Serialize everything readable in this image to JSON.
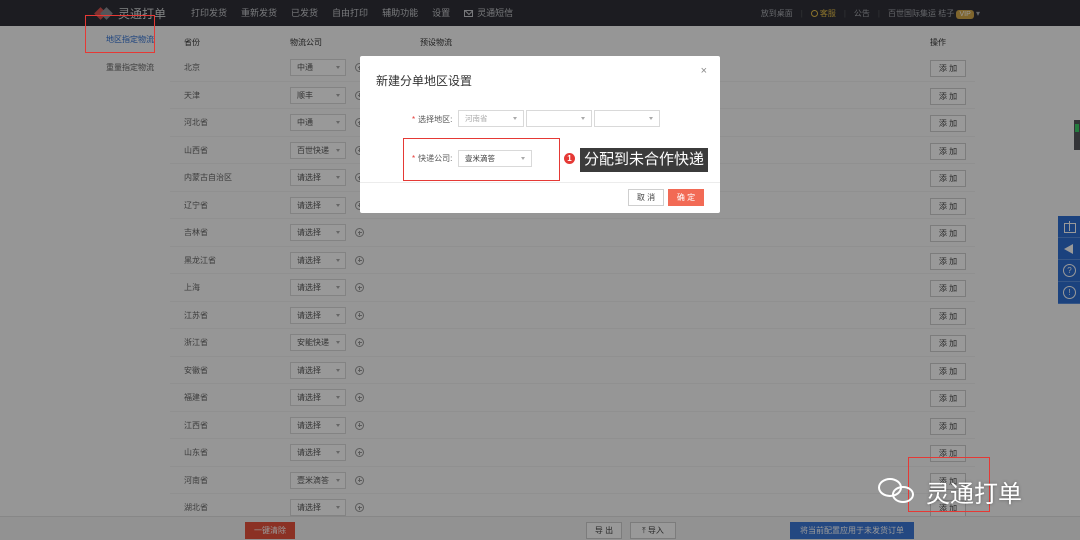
{
  "app": {
    "name": "灵通打单"
  },
  "nav": {
    "items": [
      "打印发货",
      "重新发货",
      "已发货",
      "自由打印",
      "辅助功能",
      "设置"
    ],
    "sms": "灵通短信"
  },
  "topright": {
    "desktop": "放到桌面",
    "service": "客服",
    "announce": "公告",
    "shop": "百世国际集运 桔子",
    "vip": "VIP"
  },
  "sidebar": {
    "items": [
      "地区指定物流",
      "重量指定物流"
    ]
  },
  "table": {
    "headers": {
      "province": "省份",
      "company": "物流公司",
      "preset": "预设物流",
      "action": "操作"
    },
    "add_label": "添 加",
    "rows": [
      {
        "province": "北京",
        "company": "中通"
      },
      {
        "province": "天津",
        "company": "顺丰"
      },
      {
        "province": "河北省",
        "company": "中通"
      },
      {
        "province": "山西省",
        "company": "百世快递"
      },
      {
        "province": "内蒙古自治区",
        "company": "请选择"
      },
      {
        "province": "辽宁省",
        "company": "请选择"
      },
      {
        "province": "吉林省",
        "company": "请选择"
      },
      {
        "province": "黑龙江省",
        "company": "请选择"
      },
      {
        "province": "上海",
        "company": "请选择"
      },
      {
        "province": "江苏省",
        "company": "请选择"
      },
      {
        "province": "浙江省",
        "company": "安能快递"
      },
      {
        "province": "安徽省",
        "company": "请选择"
      },
      {
        "province": "福建省",
        "company": "请选择"
      },
      {
        "province": "江西省",
        "company": "请选择"
      },
      {
        "province": "山东省",
        "company": "请选择"
      },
      {
        "province": "河南省",
        "company": "壹米滴答"
      },
      {
        "province": "湖北省",
        "company": "请选择"
      }
    ]
  },
  "footer": {
    "clear": "一键清除",
    "export": "导 出",
    "import": "导入",
    "apply": "将当前配置应用于未发货订单"
  },
  "modal": {
    "title": "新建分单地区设置",
    "close": "×",
    "region_label": "选择地区:",
    "region_values": [
      "河南省",
      "",
      ""
    ],
    "company_label": "快递公司:",
    "company_value": "壹米滴答",
    "cancel": "取 消",
    "ok": "确 定"
  },
  "annotation": {
    "number": "1",
    "text": "分配到未合作快递"
  },
  "watermark": {
    "text": "灵通打单"
  },
  "colors": {
    "accent_red": "#e53935",
    "primary_blue": "#2e6fd3",
    "confirm": "#f26a55"
  }
}
